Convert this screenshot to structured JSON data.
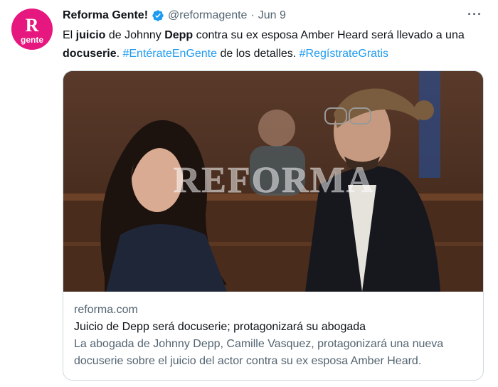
{
  "account": {
    "display_name": "Reforma Gente!",
    "handle": "@reformagente",
    "separator": "·",
    "date": "Jun 9",
    "avatar_big": "R",
    "avatar_small": "gente"
  },
  "tweet": {
    "t1": "El ",
    "t2": "juicio",
    "t3": " de Johnny ",
    "t4": "Depp",
    "t5": " contra su ex esposa Amber Heard será llevado a una ",
    "t6": "docuserie",
    "t7": ". ",
    "hashtag1": "#EntérateEnGente",
    "t8": " de los detalles. ",
    "hashtag2": "#RegístrateGratis"
  },
  "card": {
    "watermark": "REFORMA",
    "domain": "reforma.com",
    "title": "Juicio de Depp será docuserie; protagonizará su abogada",
    "desc1": "La abogada de Johnny Depp, Camille Vasquez, protagonizará una nueva docuserie sobre el ",
    "desc_bold": "juicio",
    "desc2": " del actor contra su ex esposa Amber Heard."
  },
  "colors": {
    "accent": "#1d9bf0",
    "avatar_bg": "#e6177e",
    "muted": "#536471"
  },
  "icons": {
    "verified": "verified-badge-icon",
    "more": "more-options-icon"
  }
}
